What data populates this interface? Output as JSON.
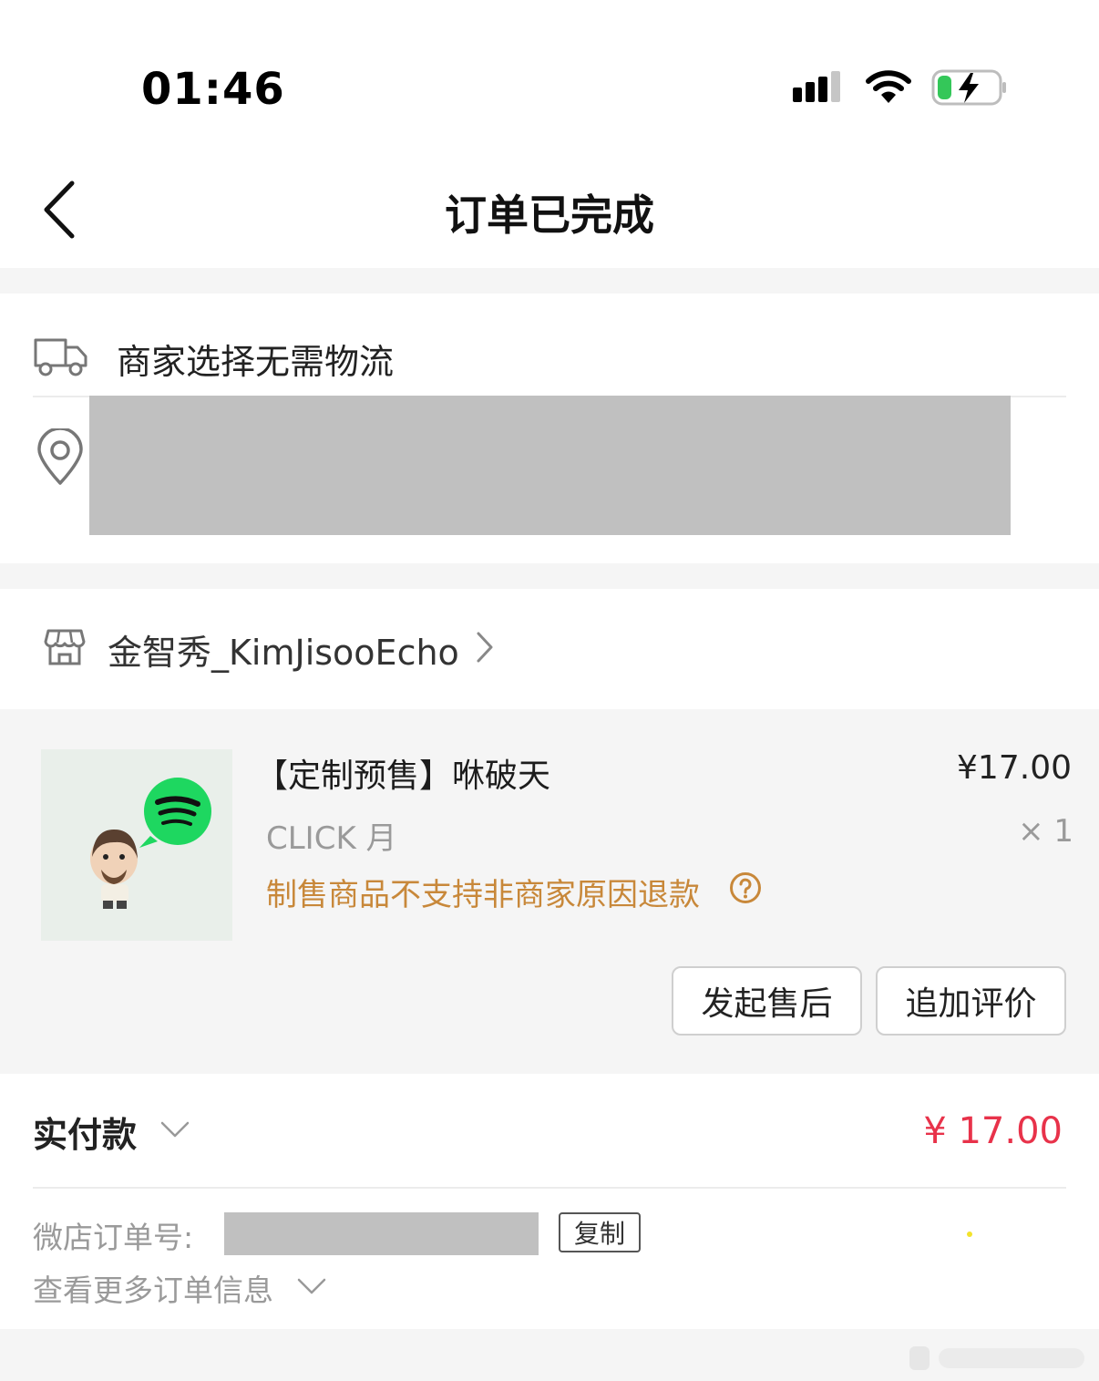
{
  "status_bar": {
    "time": "01:46",
    "icons": [
      "signal-icon",
      "wifi-icon",
      "battery-charging-icon"
    ]
  },
  "nav": {
    "title": "订单已完成",
    "back_icon": "chevron-left-icon"
  },
  "logistics": {
    "icon": "truck-icon",
    "text": "商家选择无需物流",
    "address_icon": "location-pin-icon"
  },
  "shop": {
    "icon": "store-icon",
    "name": "金智秀_KimJisooEcho",
    "chevron": "chevron-right-icon"
  },
  "product": {
    "name": "【定制预售】咻破天",
    "price": "¥17.00",
    "spec": "CLICK 月",
    "quantity": "× 1",
    "refund_note": "制售商品不支持非商家原因退款",
    "help_icon": "question-circle-icon"
  },
  "actions": {
    "after_sale": "发起售后",
    "add_review": "追加评价"
  },
  "payment": {
    "label": "实付款",
    "amount": "¥ 17.00"
  },
  "order_info": {
    "order_no_label": "微店订单号:",
    "copy_label": "复制",
    "more_label": "查看更多订单信息"
  },
  "colors": {
    "accent_price": "#e8324a",
    "refund_note": "#c8883a",
    "spotify_green": "#1ed760"
  }
}
